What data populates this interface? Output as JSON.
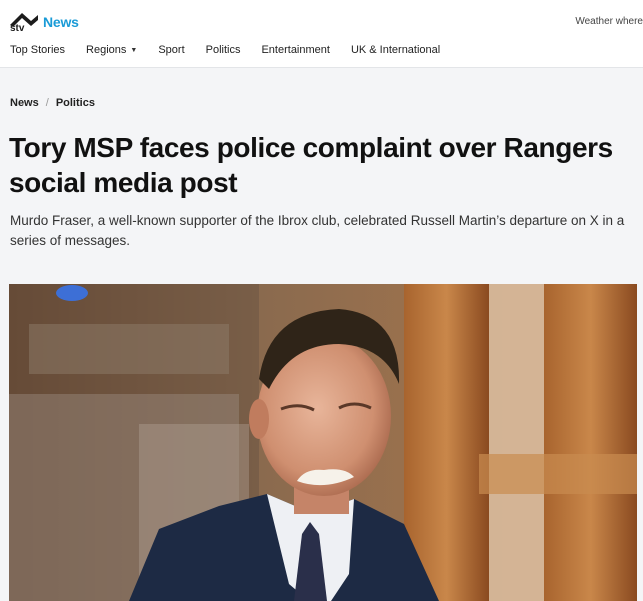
{
  "site": {
    "logo_text": "stv",
    "section_label": "News",
    "weather_text": "Weather where"
  },
  "nav": {
    "items": [
      {
        "label": "Top Stories"
      },
      {
        "label": "Regions"
      },
      {
        "label": "Sport"
      },
      {
        "label": "Politics"
      },
      {
        "label": "Entertainment"
      },
      {
        "label": "UK & International"
      }
    ]
  },
  "breadcrumb": {
    "items": [
      {
        "label": "News"
      },
      {
        "label": "Politics"
      }
    ],
    "separator": "/"
  },
  "article": {
    "headline": "Tory MSP faces police complaint over Rangers social media post",
    "standfirst": "Murdo Fraser, a well-known supporter of the Ibrox club, celebrated Russell Martin’s departure on X in a series of messages."
  },
  "colors": {
    "brand_blue": "#1a9bd7",
    "page_bg": "#f4f5f7"
  }
}
